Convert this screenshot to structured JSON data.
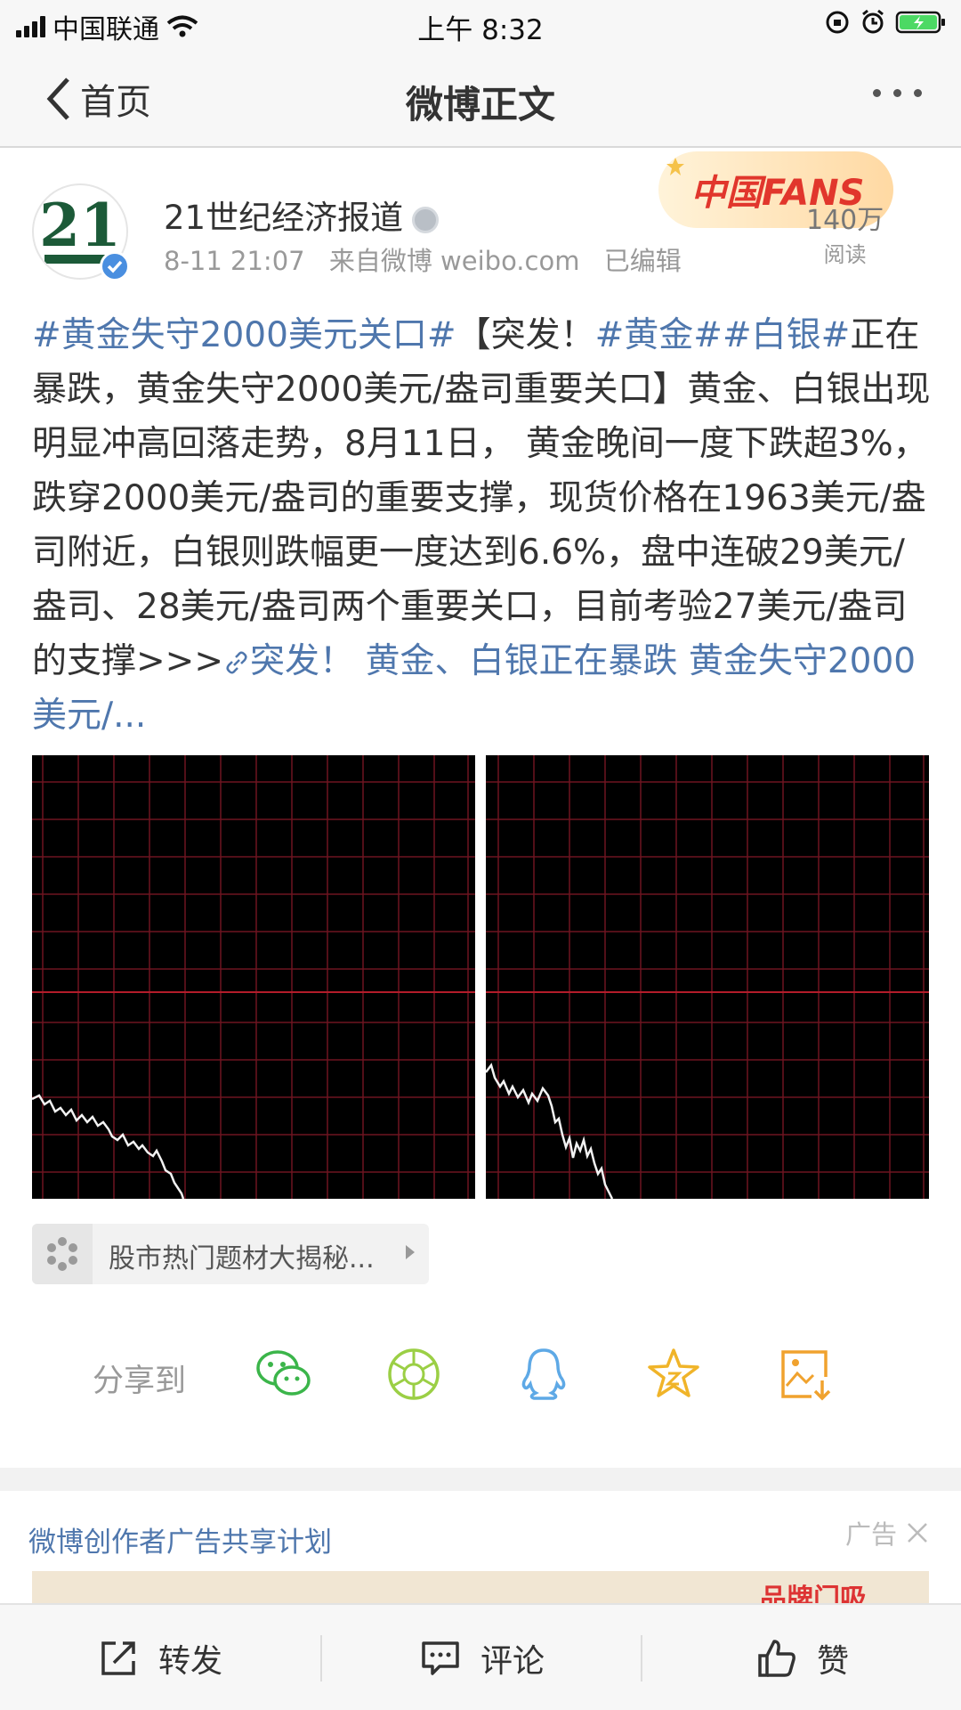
{
  "status_bar": {
    "carrier": "中国联通",
    "time": "上午 8:32"
  },
  "nav": {
    "back_label": "首页",
    "title": "微博正文"
  },
  "post": {
    "avatar_text": "21",
    "author": "21世纪经济报道",
    "date": "8-11 21:07",
    "source": "来自微博 weibo.com",
    "edited": "已编辑",
    "badge_label": "中国FANS",
    "reads_count": "140万",
    "reads_label": "阅读",
    "text": {
      "tag1": "#黄金失守2000美元关口#",
      "t1": "【突发！",
      "tag2": "#黄金#",
      "tag3": "#白银#",
      "t2": "正在暴跌，黄金失守2000美元/盎司重要关口】黄金、白银出现明显冲高回落走势，8月11日， 黄金晚间一度下跌超3%，跌穿2000美元/盎司的重要支撑，现货价格在1963美元/盎司附近，白银则跌幅更一度达到6.6%，盘中连破29美元/盎司、28美元/盎司两个重要关口，目前考验27美元/盎司的支撑>>>",
      "link": "突发！ 黄金、白银正在暴跌 黄金失守2000美元/..."
    },
    "topic_label": "股市热门题材大揭秘..."
  },
  "share": {
    "label": "分享到",
    "icons": [
      "wechat-icon",
      "moments-icon",
      "qq-icon",
      "favorite-star-icon",
      "save-image-icon"
    ]
  },
  "ad": {
    "title": "微博创作者广告共享计划",
    "tag": "广告",
    "banner_text": "品牌门吸"
  },
  "toolbar": {
    "repost": "转发",
    "comment": "评论",
    "like": "赞"
  },
  "colors": {
    "link_blue": "#4f77ad",
    "chart_grid": "#7a1622",
    "chart_mid": "#b31c2a"
  }
}
